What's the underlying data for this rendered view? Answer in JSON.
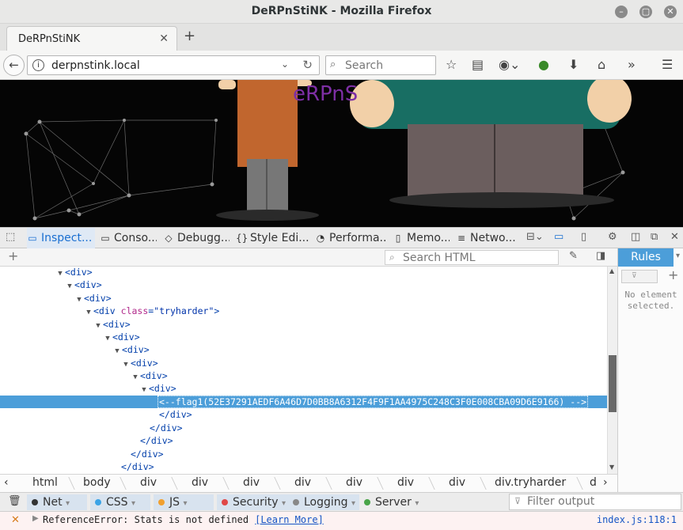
{
  "window": {
    "title": "DeRPnStiNK - Mozilla Firefox"
  },
  "tab": {
    "label": "DeRPnStiNK"
  },
  "navbar": {
    "url": "derpnstink.local",
    "search_placeholder": "Search"
  },
  "page": {
    "banner_text": "eRPnS"
  },
  "devtools": {
    "tabs": [
      "Inspect...",
      "Conso...",
      "Debugg...",
      "Style Edi...",
      "Performa...",
      "Memo...",
      "Netwo..."
    ],
    "search_html_placeholder": "Search HTML",
    "rules_tab": "Rules",
    "no_element_1": "No element",
    "no_element_2": "selected."
  },
  "markup": {
    "div": "<div>",
    "div_close": "</div>",
    "tryharder_open": "<div",
    "tryharder_attr_name": "class",
    "tryharder_attr_eq": "=",
    "tryharder_attr_value": "\"tryharder\"",
    "tryharder_close": ">",
    "flag_comment": "<--flag1(52E37291AEDF6A46D7D0BB8A6312F4F9F1AA4975C248C3F0E008CBA09D6E9166) -->"
  },
  "breadcrumbs": [
    "html",
    "body",
    "div",
    "div",
    "div",
    "div",
    "div",
    "div",
    "div",
    "div.tryharder",
    "d"
  ],
  "console": {
    "filters": [
      "Net",
      "CSS",
      "JS",
      "Security",
      "Logging",
      "Server"
    ],
    "filter_output_placeholder": "Filter output",
    "message": "ReferenceError: Stats is not defined",
    "learn_more": "[Learn More]",
    "location": "index.js:118:1"
  },
  "colors": {
    "accent": "#4c9ed9",
    "page_bg": "#050505"
  }
}
